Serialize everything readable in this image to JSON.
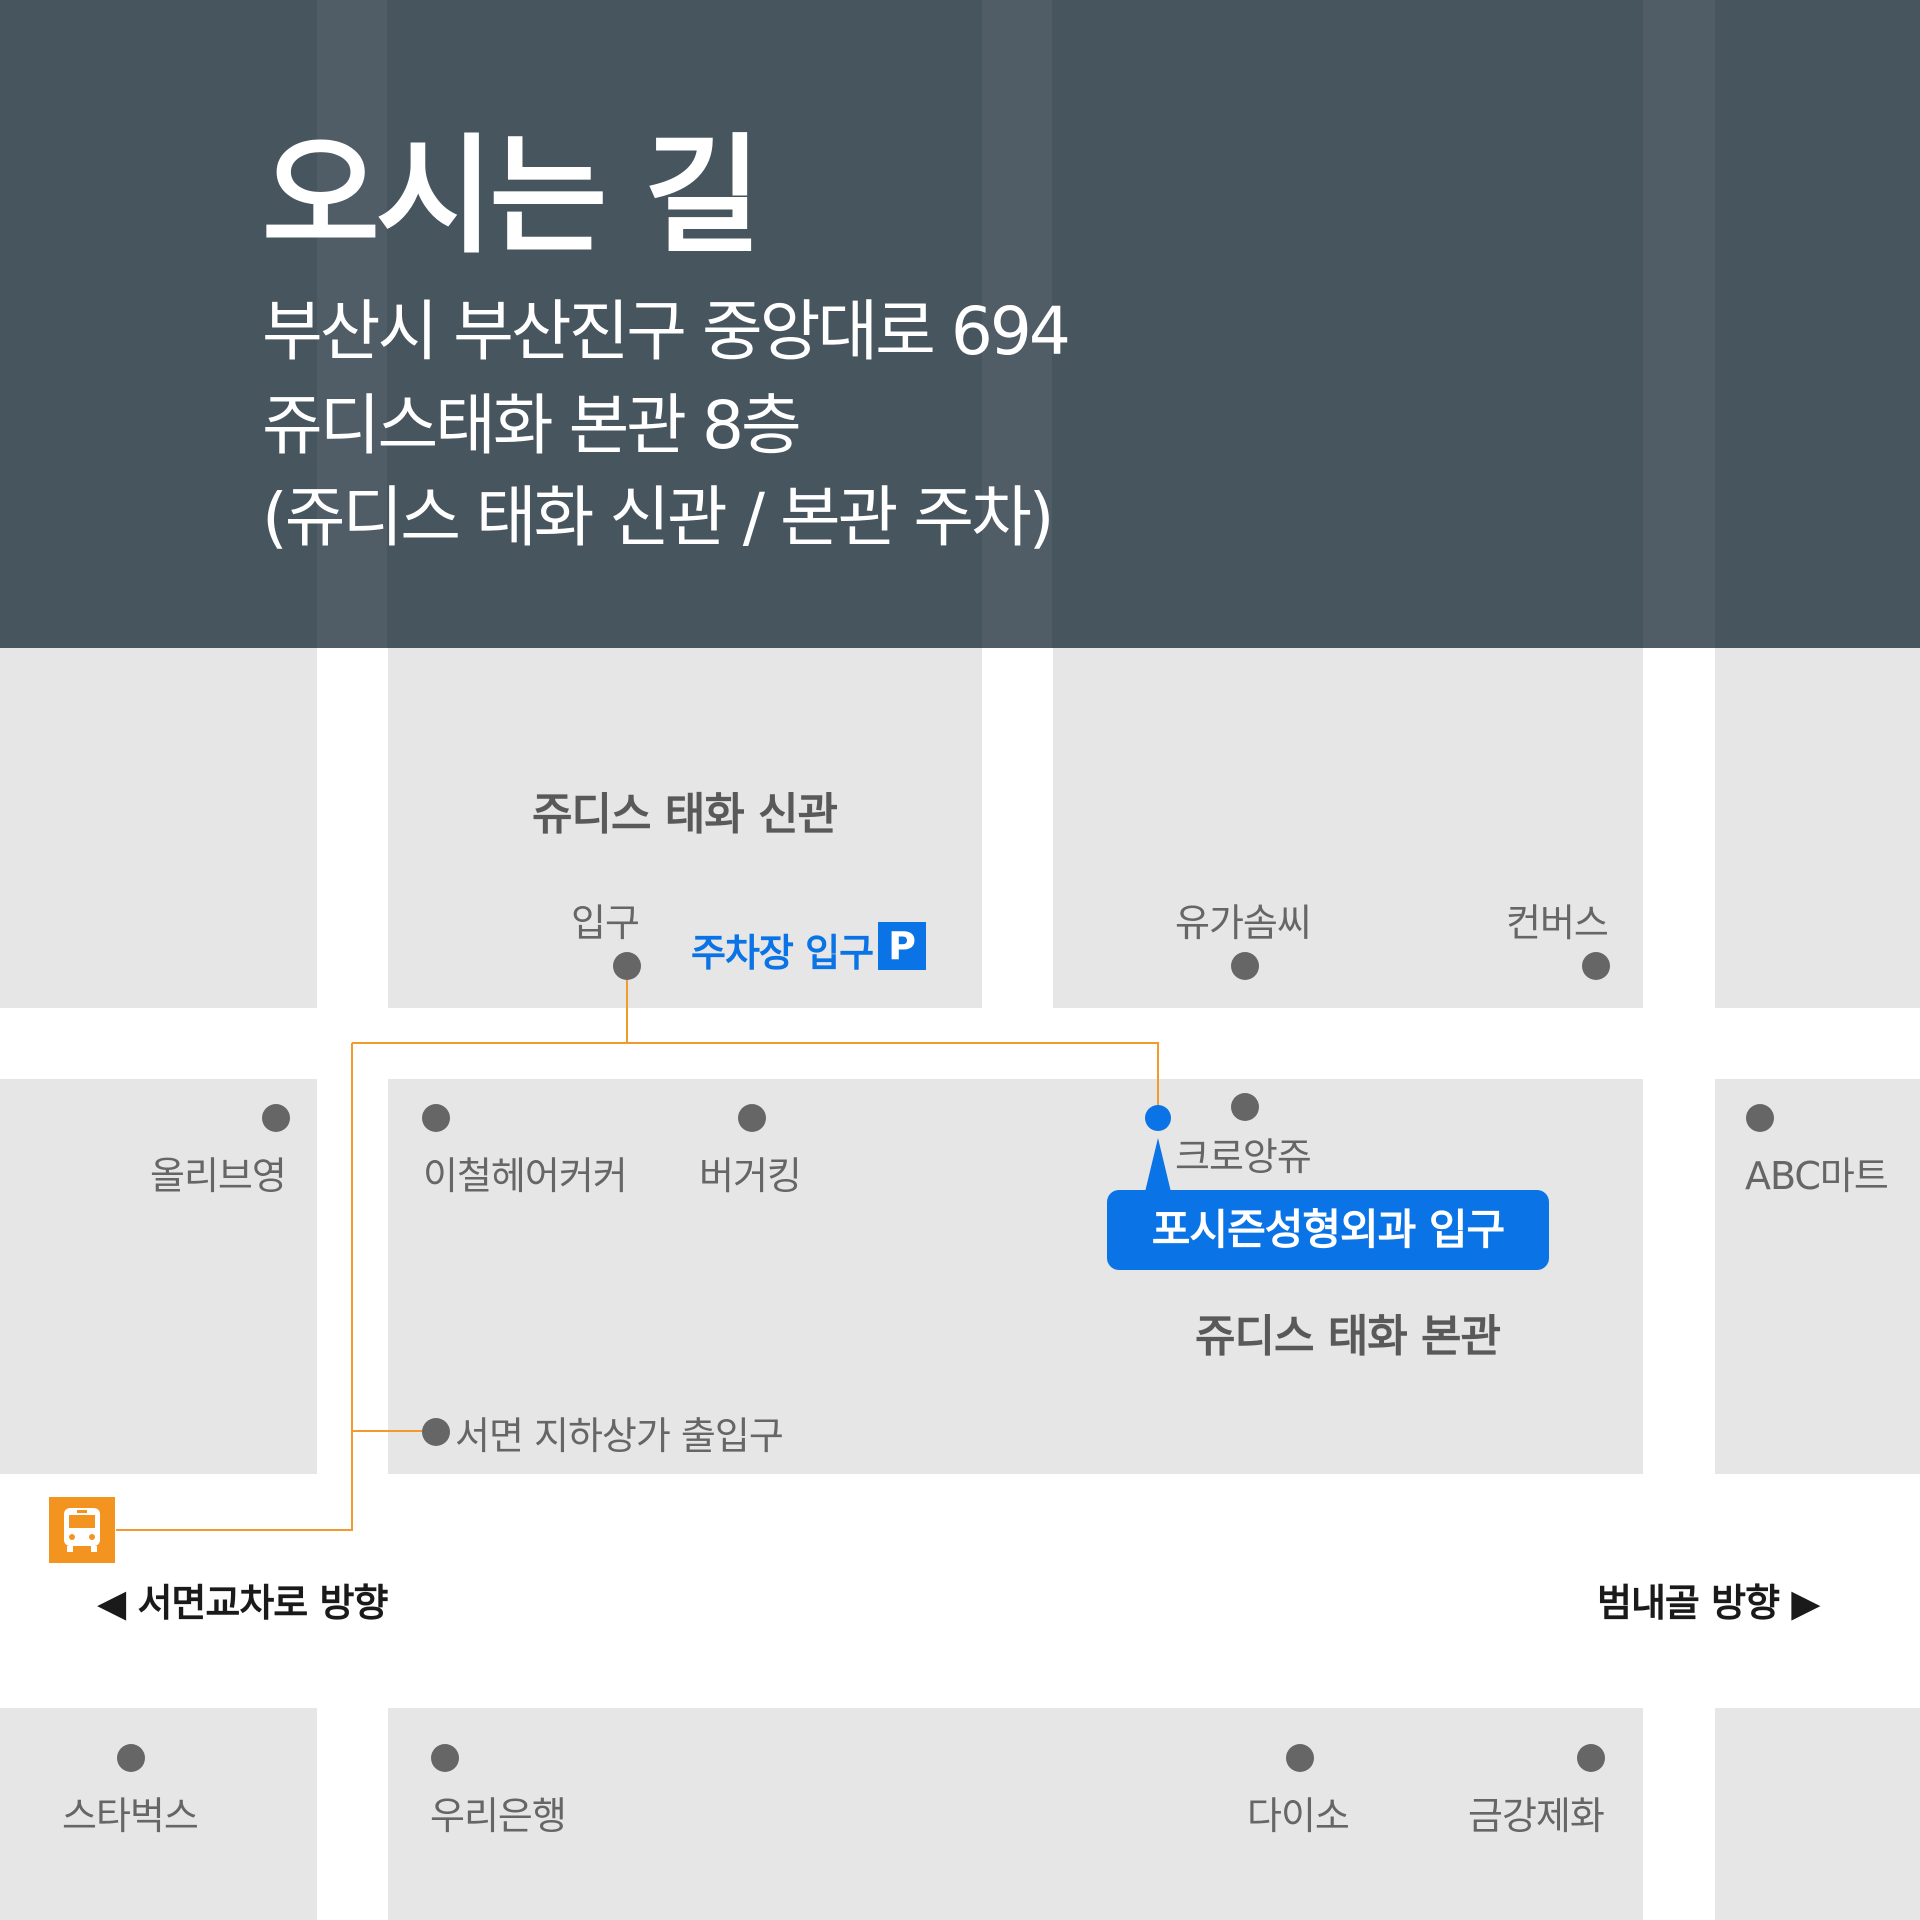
{
  "header": {
    "title": "오시는 길",
    "address_lines": [
      "부산시 부산진구 중앙대로 694",
      "쥬디스태화 본관 8층",
      "(쥬디스 태화 신관 / 본관 주차)"
    ],
    "bg_color": "#47555e"
  },
  "buildings": {
    "new_wing": "쥬디스 태화 신관",
    "main_building": "쥬디스 태화 본관"
  },
  "labels": {
    "entrance": "입구",
    "parking_entrance": "주차장 입구",
    "parking_symbol": "P",
    "yoogasomssi": "유가솜씨",
    "converse": "컨버스",
    "oliveyoung": "올리브영",
    "leechul_haircare": "이철헤어커커",
    "burgerking": "버거킹",
    "crocs": "크로앙쥬",
    "abc_mart": "ABC마트",
    "clinic_entrance": "포시즌성형외과 입구",
    "seomyeon_underground": "서면 지하상가 출입구",
    "starbucks": "스타벅스",
    "woori_bank": "우리은행",
    "daiso": "다이소",
    "geumgang_shoes": "금강제화"
  },
  "directions": {
    "left": "◀ 서면교차로 방향",
    "right": "범내골 방향 ▶"
  },
  "icons": {
    "bus_stop": "bus-stop-icon",
    "parking": "parking-icon"
  },
  "colors": {
    "accent_blue": "#0a73e6",
    "route_orange": "#f29a2e",
    "bus_orange": "#f39320",
    "block_gray": "#e6e6e6",
    "poi_dot": "#666666"
  }
}
